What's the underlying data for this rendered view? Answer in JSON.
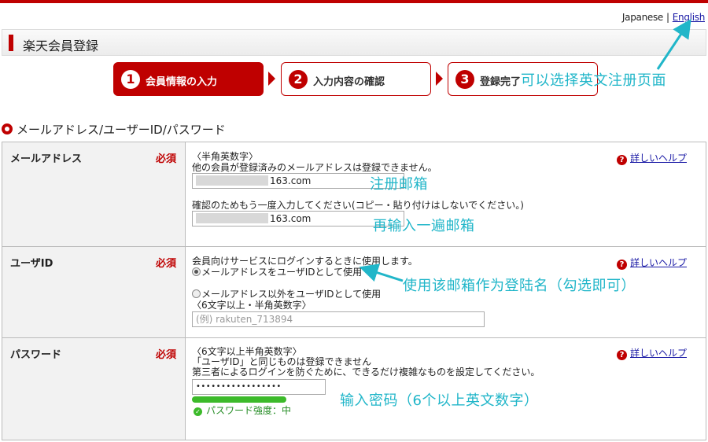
{
  "language": {
    "current": "Japanese",
    "separator": "|",
    "english_link": "English"
  },
  "header": {
    "title": "楽天会員登録"
  },
  "steps": [
    {
      "num": "1",
      "label": "会員情報の入力",
      "active": true
    },
    {
      "num": "2",
      "label": "入力内容の確認",
      "active": false
    },
    {
      "num": "3",
      "label": "登録完了",
      "active": false
    }
  ],
  "section": {
    "title": "メールアドレス/ユーザーID/パスワード"
  },
  "required_label": "必須",
  "help_link": "詳しいヘルプ",
  "email": {
    "label": "メールアドレス",
    "format": "〈半角英数字〉",
    "note": "他の会員が登録済みのメールアドレスは登録できません。",
    "value": "163.com",
    "confirm_note": "確認のためもう一度入力してください(コピー・貼り付けはしないでください。)",
    "confirm_value": "163.com"
  },
  "userid": {
    "label": "ユーザID",
    "note": "会員向けサービスにログインするときに使用します。",
    "option1": "メールアドレスをユーザIDとして使用",
    "option2": "メールアドレス以外をユーザIDとして使用",
    "format": "〈6文字以上・半角英数字〉",
    "placeholder": "(例) rakuten_713894"
  },
  "password": {
    "label": "パスワード",
    "format": "〈6文字以上半角英数字〉",
    "note1": "「ユーザID」と同じものは登録できません",
    "note2": "第三者によるログインを防ぐために、できるだけ複雑なものを設定してください。",
    "value": "•••••••••••••••••",
    "strength_label": "パスワード強度：中",
    "strength_level": 0.5
  },
  "annotations": {
    "english": "可以选择英文注册页面",
    "email": "注册邮箱",
    "confirm": "再输入一遍邮箱",
    "userid": "使用该邮箱作为登陆名（勾选即可）",
    "password": "输入密码（6个以上英文数字）"
  },
  "colors": {
    "brand": "#bf0000",
    "annotation": "#21b6c9",
    "strength": "#3cba2a",
    "link": "#1a1aa6"
  }
}
